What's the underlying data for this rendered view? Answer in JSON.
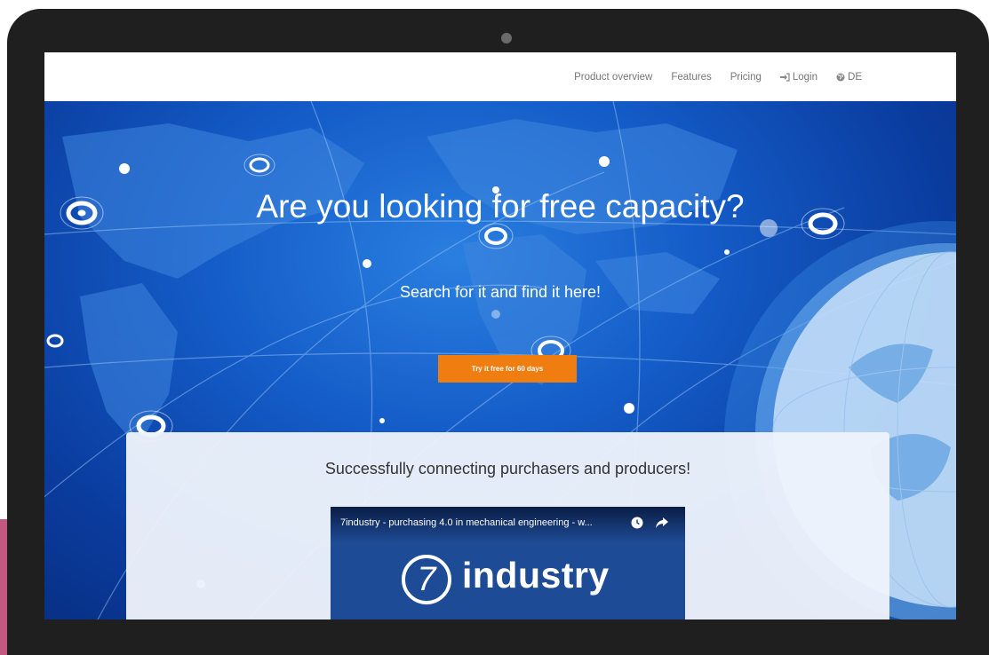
{
  "nav": {
    "links": [
      "Product overview",
      "Features",
      "Pricing"
    ],
    "login_label": "Login",
    "lang_label": "DE"
  },
  "hero": {
    "title": "Are you looking for free capacity?",
    "subtitle": "Search for it and find it here!",
    "cta_label": "Try it free for 60 days"
  },
  "panel": {
    "title": "Successfully connecting purchasers and producers!"
  },
  "video": {
    "title": "7industry - purchasing 4.0 in mechanical engineering - w...",
    "logo_numeral": "7",
    "logo_word": "industry"
  },
  "icons": [
    "login-icon",
    "globe-icon",
    "clock-icon",
    "share-icon"
  ],
  "colors": {
    "cta": "#f07d10",
    "device_frame": "#1f1f1f",
    "hero_blue": "#145cc8",
    "video_bg": "#1e4b95",
    "accent_pink": "#c2577f"
  }
}
